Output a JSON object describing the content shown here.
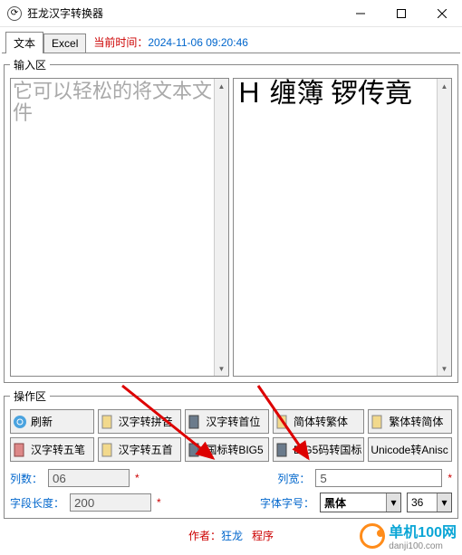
{
  "window": {
    "title": "狂龙汉字转换器"
  },
  "tabs": {
    "text": "文本",
    "excel": "Excel"
  },
  "time": {
    "label": "当前时间：",
    "value": "2024-11-06  09:20:46"
  },
  "input_area": {
    "legend": "输入区",
    "left_text": "它可以轻松的将文本文件",
    "right_text": "Ｈ 缠簿   锣传竟"
  },
  "op_area": {
    "legend": "操作区",
    "buttons": {
      "refresh": "刷新",
      "hz2py": "汉字转拼音",
      "hz2sw": "汉字转首位",
      "jt2ft": "简体转繁体",
      "ft2jt": "繁体转简体",
      "hz2wb": "汉字转五笔",
      "hz2ws": "汉字转五首",
      "gb2big5": "国标转BIG5",
      "big52gb": "BIG5码转国标",
      "uni2ansi": "Unicode转Anisc"
    }
  },
  "form": {
    "cols_label": "列数：",
    "cols_value": "06",
    "colw_label": "列宽：",
    "colw_value": "5",
    "flen_label": "字段长度：",
    "flen_value": "200",
    "font_label": "字体字号：",
    "font_value": "黑体",
    "size_value": "36",
    "star": "*"
  },
  "footer": {
    "author_lbl": "作者：",
    "author": "狂龙",
    "prog_lbl": "程序"
  },
  "watermark": {
    "text1": "单机100网",
    "text2": "danji100.com"
  }
}
